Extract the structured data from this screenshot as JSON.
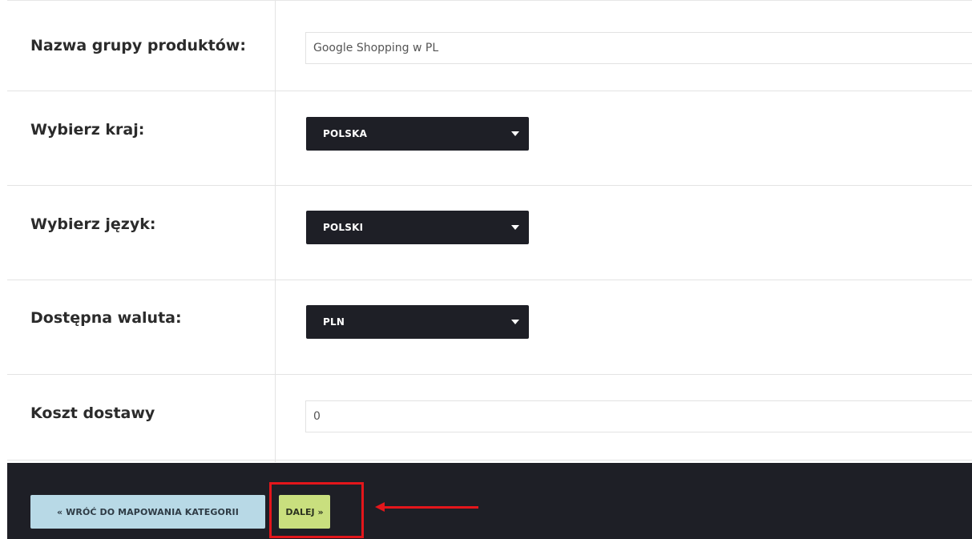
{
  "form": {
    "rows": [
      {
        "label": "Nazwa grupy produktów:",
        "control": "text",
        "value": "Google Shopping w PL"
      },
      {
        "label": "Wybierz kraj:",
        "control": "select",
        "value": "POLSKA"
      },
      {
        "label": "Wybierz język:",
        "control": "select",
        "value": "POLSKI"
      },
      {
        "label": "Dostępna waluta:",
        "control": "select",
        "value": "PLN"
      },
      {
        "label": "Koszt dostawy",
        "control": "text",
        "value": "0"
      }
    ]
  },
  "footer": {
    "back_label": "« WRÓĆ DO MAPOWANIA KATEGORII",
    "next_label": "DALEJ »"
  },
  "annotation": {
    "highlight_color": "#e3161b",
    "target": "next-button"
  },
  "colors": {
    "dark": "#1e1f26",
    "back_button": "#b8d9e6",
    "next_button": "#c9df7e"
  }
}
